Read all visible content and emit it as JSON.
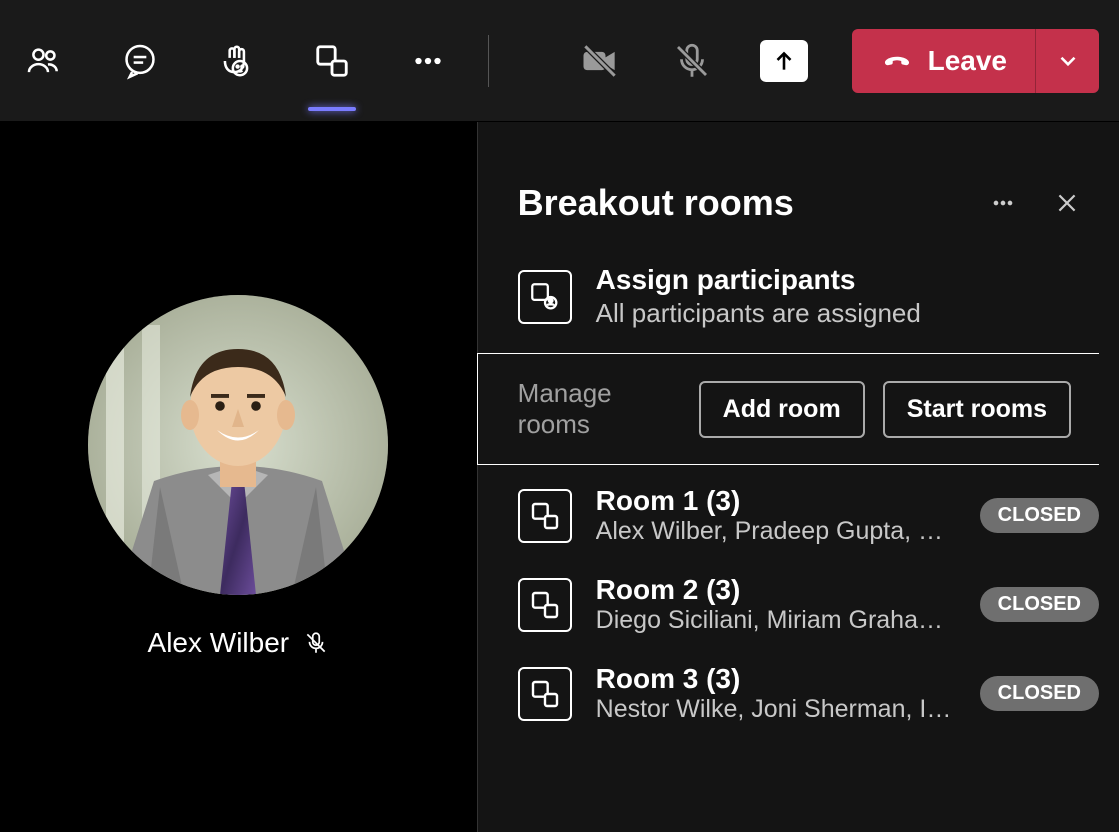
{
  "toolbar": {
    "leave_label": "Leave"
  },
  "stage": {
    "participant_name": "Alex Wilber"
  },
  "panel": {
    "title": "Breakout rooms",
    "assign": {
      "title": "Assign participants",
      "subtitle": "All participants are assigned"
    },
    "manage": {
      "label": "Manage rooms",
      "add_label": "Add room",
      "start_label": "Start rooms"
    },
    "rooms": [
      {
        "title": "Room 1 (3)",
        "members": "Alex Wilber, Pradeep Gupta, De…",
        "status": "CLOSED"
      },
      {
        "title": "Room 2 (3)",
        "members": "Diego Siciliani, Miriam Graham, …",
        "status": "CLOSED"
      },
      {
        "title": "Room 3 (3)",
        "members": "Nestor Wilke, Joni Sherman, Isai…",
        "status": "CLOSED"
      }
    ]
  }
}
